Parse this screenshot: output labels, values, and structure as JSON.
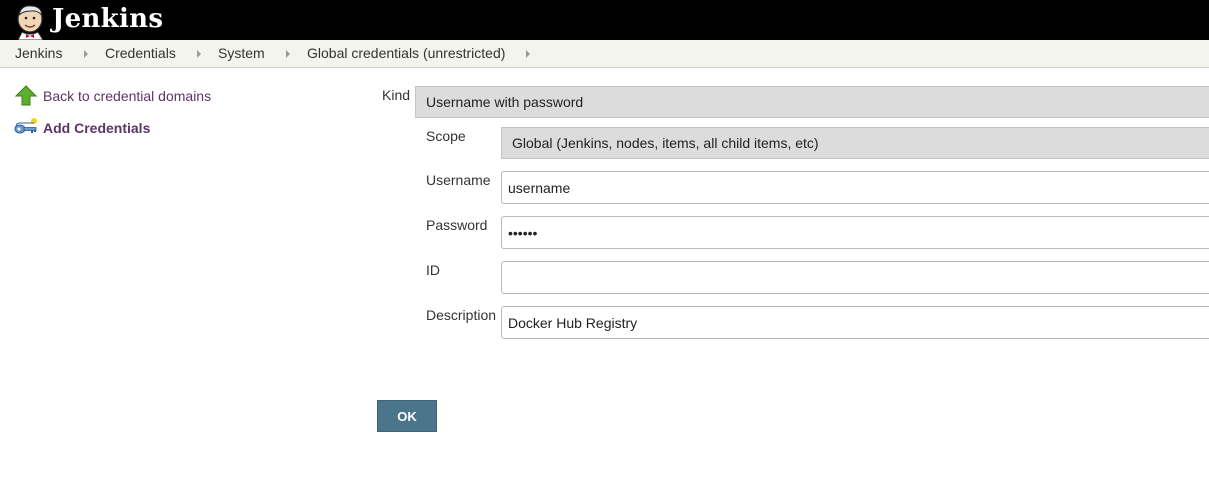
{
  "app": {
    "title": "Jenkins"
  },
  "breadcrumbs": [
    {
      "label": "Jenkins"
    },
    {
      "label": "Credentials"
    },
    {
      "label": "System"
    },
    {
      "label": "Global credentials (unrestricted)"
    }
  ],
  "sidebar": {
    "items": [
      {
        "label": "Back to credential domains",
        "icon": "up-arrow-icon"
      },
      {
        "label": "Add Credentials",
        "icon": "key-icon"
      }
    ]
  },
  "form": {
    "kind": {
      "label": "Kind",
      "value": "Username with password"
    },
    "scope": {
      "label": "Scope",
      "value": "Global (Jenkins, nodes, items, all child items, etc)"
    },
    "username": {
      "label": "Username",
      "value": "username"
    },
    "password": {
      "label": "Password",
      "value": "••••••"
    },
    "id": {
      "label": "ID",
      "value": ""
    },
    "description": {
      "label": "Description",
      "value": "Docker Hub Registry"
    },
    "ok_label": "OK"
  },
  "colors": {
    "header_bg": "#000000",
    "breadcrumb_bg": "#f3f4ee",
    "link": "#5c3566",
    "button_bg": "#4b758b",
    "select_bg": "#dcdcdc"
  }
}
